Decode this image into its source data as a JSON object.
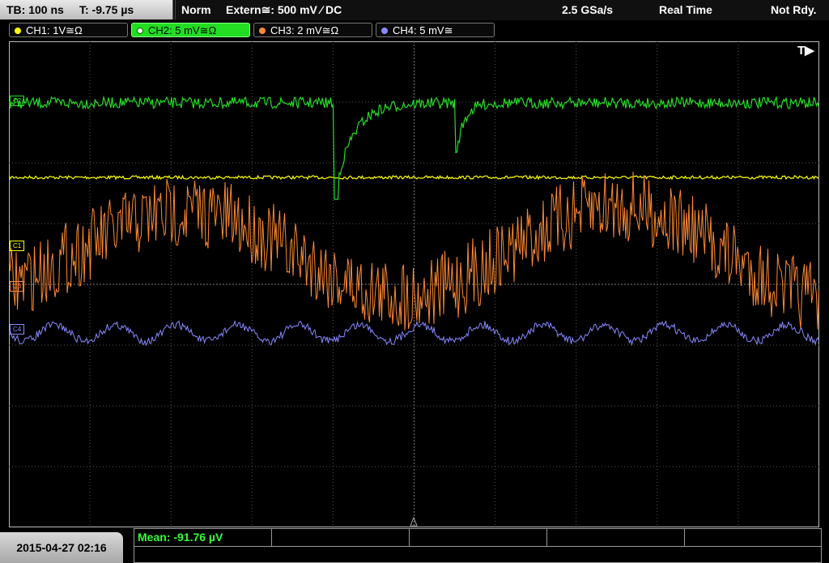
{
  "top": {
    "timebase": "TB: 100 ns",
    "time_offset": "T: -9.75 µs",
    "mode": "Norm",
    "trigger": "Extern≅: 500 mV ⁄ DC",
    "sample_rate": "2.5 GSa/s",
    "acq_mode": "Real Time",
    "status": "Not Rdy."
  },
  "channels": [
    {
      "label": "CH1: 1V≅Ω",
      "color": "#ffff00"
    },
    {
      "label": "CH2: 5 mV≅Ω",
      "color": "#22dd22"
    },
    {
      "label": "CH3: 2 mV≅Ω",
      "color": "#ff8833"
    },
    {
      "label": "CH4: 5 mV≅",
      "color": "#8888ff"
    }
  ],
  "markers": {
    "c1": "C1",
    "c2": "C2",
    "c3": "C3",
    "c4": "C4"
  },
  "trigger_marker": "T▶",
  "date": "2015-04-27 02:16",
  "measurement": {
    "mean": "Mean: -91.76 µV"
  }
}
